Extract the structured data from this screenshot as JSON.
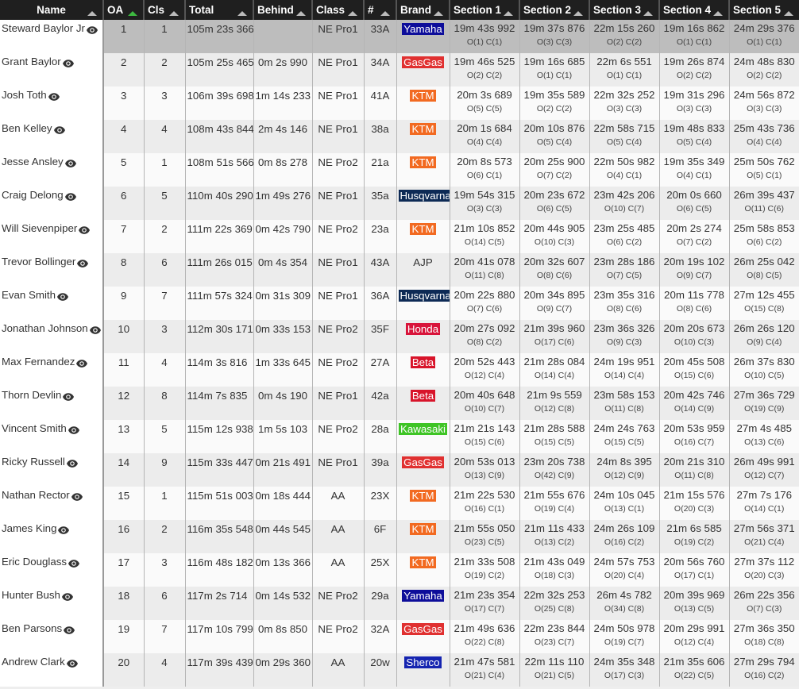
{
  "columns": [
    {
      "key": "name",
      "label": "Name"
    },
    {
      "key": "oa",
      "label": "OA",
      "sort_active": true
    },
    {
      "key": "cls",
      "label": "Cls"
    },
    {
      "key": "total",
      "label": "Total"
    },
    {
      "key": "behind",
      "label": "Behind"
    },
    {
      "key": "class",
      "label": "Class"
    },
    {
      "key": "bib",
      "label": "#"
    },
    {
      "key": "brand",
      "label": "Brand"
    },
    {
      "key": "s1",
      "label": "Section 1"
    },
    {
      "key": "s2",
      "label": "Section 2"
    },
    {
      "key": "s3",
      "label": "Section 3"
    },
    {
      "key": "s4",
      "label": "Section 4"
    },
    {
      "key": "s5",
      "label": "Section 5"
    }
  ],
  "brand_colors": {
    "Yamaha": "#0d0d9a",
    "GasGas": "#e03030",
    "KTM": "#f26a21",
    "Husqvarna": "#0d2a55",
    "AJP": "",
    "Honda": "#d8143a",
    "Beta": "#d8142a",
    "Kawasaki": "#3ec425",
    "Sherco": "#1524b0"
  },
  "rows": [
    {
      "name": "Steward Baylor Jr",
      "oa": "1",
      "cls": "1",
      "total": "105m 23s 366",
      "behind": "",
      "class": "NE Pro1",
      "bib": "33A",
      "brand": "Yamaha",
      "selected": true,
      "sections": [
        [
          "19m 43s 992",
          "O(1) C(1)"
        ],
        [
          "19m 37s 876",
          "O(3) C(3)"
        ],
        [
          "22m 15s 260",
          "O(2) C(2)"
        ],
        [
          "19m 16s 862",
          "O(1) C(1)"
        ],
        [
          "24m 29s 376",
          "O(1) C(1)"
        ]
      ]
    },
    {
      "name": "Grant Baylor",
      "oa": "2",
      "cls": "2",
      "total": "105m 25s 465",
      "behind": "0m 2s 990",
      "class": "NE Pro1",
      "bib": "34A",
      "brand": "GasGas",
      "sections": [
        [
          "19m 46s 525",
          "O(2) C(2)"
        ],
        [
          "19m 16s 685",
          "O(1) C(1)"
        ],
        [
          "22m 6s 551",
          "O(1) C(1)"
        ],
        [
          "19m 26s 874",
          "O(2) C(2)"
        ],
        [
          "24m 48s 830",
          "O(2) C(2)"
        ]
      ]
    },
    {
      "name": "Josh Toth",
      "oa": "3",
      "cls": "3",
      "total": "106m 39s 698",
      "behind": "1m 14s 233",
      "class": "NE Pro1",
      "bib": "41A",
      "brand": "KTM",
      "sections": [
        [
          "20m 3s 689",
          "O(5) C(5)"
        ],
        [
          "19m 35s 589",
          "O(2) C(2)"
        ],
        [
          "22m 32s 252",
          "O(3) C(3)"
        ],
        [
          "19m 31s 296",
          "O(3) C(3)"
        ],
        [
          "24m 56s 872",
          "O(3) C(3)"
        ]
      ]
    },
    {
      "name": "Ben Kelley",
      "oa": "4",
      "cls": "4",
      "total": "108m 43s 844",
      "behind": "2m 4s 146",
      "class": "NE Pro1",
      "bib": "38a",
      "brand": "KTM",
      "sections": [
        [
          "20m 1s 684",
          "O(4) C(4)"
        ],
        [
          "20m 10s 876",
          "O(5) C(4)"
        ],
        [
          "22m 58s 715",
          "O(5) C(4)"
        ],
        [
          "19m 48s 833",
          "O(5) C(4)"
        ],
        [
          "25m 43s 736",
          "O(4) C(4)"
        ]
      ]
    },
    {
      "name": "Jesse Ansley",
      "oa": "5",
      "cls": "1",
      "total": "108m 51s 566",
      "behind": "0m 8s 278",
      "class": "NE Pro2",
      "bib": "21a",
      "brand": "KTM",
      "sections": [
        [
          "20m 8s 573",
          "O(6) C(1)"
        ],
        [
          "20m 25s 900",
          "O(7) C(2)"
        ],
        [
          "22m 50s 982",
          "O(4) C(1)"
        ],
        [
          "19m 35s 349",
          "O(4) C(1)"
        ],
        [
          "25m 50s 762",
          "O(5) C(1)"
        ]
      ]
    },
    {
      "name": "Craig Delong",
      "oa": "6",
      "cls": "5",
      "total": "110m 40s 290",
      "behind": "1m 49s 276",
      "class": "NE Pro1",
      "bib": "35a",
      "brand": "Husqvarna",
      "sections": [
        [
          "19m 54s 315",
          "O(3) C(3)"
        ],
        [
          "20m 23s 672",
          "O(6) C(5)"
        ],
        [
          "23m 42s 206",
          "O(10) C(7)"
        ],
        [
          "20m 0s 660",
          "O(6) C(5)"
        ],
        [
          "26m 39s 437",
          "O(11) C(6)"
        ]
      ]
    },
    {
      "name": "Will Sievenpiper",
      "oa": "7",
      "cls": "2",
      "total": "111m 22s 369",
      "behind": "0m 42s 790",
      "class": "NE Pro2",
      "bib": "23a",
      "brand": "KTM",
      "sections": [
        [
          "21m 10s 852",
          "O(14) C(5)"
        ],
        [
          "20m 44s 905",
          "O(10) C(3)"
        ],
        [
          "23m 25s 485",
          "O(6) C(2)"
        ],
        [
          "20m 2s 274",
          "O(7) C(2)"
        ],
        [
          "25m 58s 853",
          "O(6) C(2)"
        ]
      ]
    },
    {
      "name": "Trevor Bollinger",
      "oa": "8",
      "cls": "6",
      "total": "111m 26s 015",
      "behind": "0m 4s 354",
      "class": "NE Pro1",
      "bib": "43A",
      "brand": "AJP",
      "sections": [
        [
          "20m 41s 078",
          "O(11) C(8)"
        ],
        [
          "20m 32s 607",
          "O(8) C(6)"
        ],
        [
          "23m 28s 186",
          "O(7) C(5)"
        ],
        [
          "20m 19s 102",
          "O(9) C(7)"
        ],
        [
          "26m 25s 042",
          "O(8) C(5)"
        ]
      ]
    },
    {
      "name": "Evan Smith",
      "oa": "9",
      "cls": "7",
      "total": "111m 57s 324",
      "behind": "0m 31s 309",
      "class": "NE Pro1",
      "bib": "36A",
      "brand": "Husqvarna",
      "sections": [
        [
          "20m 22s 880",
          "O(7) C(6)"
        ],
        [
          "20m 34s 895",
          "O(9) C(7)"
        ],
        [
          "23m 35s 316",
          "O(8) C(6)"
        ],
        [
          "20m 11s 778",
          "O(8) C(6)"
        ],
        [
          "27m 12s 455",
          "O(15) C(8)"
        ]
      ]
    },
    {
      "name": "Jonathan Johnson",
      "oa": "10",
      "cls": "3",
      "total": "112m 30s 171",
      "behind": "0m 33s 153",
      "class": "NE Pro2",
      "bib": "35F",
      "brand": "Honda",
      "sections": [
        [
          "20m 27s 092",
          "O(8) C(2)"
        ],
        [
          "21m 39s 960",
          "O(17) C(6)"
        ],
        [
          "23m 36s 326",
          "O(9) C(3)"
        ],
        [
          "20m 20s 673",
          "O(10) C(3)"
        ],
        [
          "26m 26s 120",
          "O(9) C(4)"
        ]
      ]
    },
    {
      "name": "Max Fernandez",
      "oa": "11",
      "cls": "4",
      "total": "114m 3s 816",
      "behind": "1m 33s 645",
      "class": "NE Pro2",
      "bib": "27A",
      "brand": "Beta",
      "sections": [
        [
          "20m 52s 443",
          "O(12) C(4)"
        ],
        [
          "21m 28s 084",
          "O(14) C(4)"
        ],
        [
          "24m 19s 951",
          "O(14) C(4)"
        ],
        [
          "20m 45s 508",
          "O(15) C(6)"
        ],
        [
          "26m 37s 830",
          "O(10) C(5)"
        ]
      ]
    },
    {
      "name": "Thorn Devlin",
      "oa": "12",
      "cls": "8",
      "total": "114m 7s 835",
      "behind": "0m 4s 190",
      "class": "NE Pro1",
      "bib": "42a",
      "brand": "Beta",
      "sections": [
        [
          "20m 40s 648",
          "O(10) C(7)"
        ],
        [
          "21m 9s 559",
          "O(12) C(8)"
        ],
        [
          "23m 58s 153",
          "O(11) C(8)"
        ],
        [
          "20m 42s 746",
          "O(14) C(9)"
        ],
        [
          "27m 36s 729",
          "O(19) C(9)"
        ]
      ]
    },
    {
      "name": "Vincent Smith",
      "oa": "13",
      "cls": "5",
      "total": "115m 12s 938",
      "behind": "1m 5s 103",
      "class": "NE Pro2",
      "bib": "28a",
      "brand": "Kawasaki",
      "sections": [
        [
          "21m 21s 143",
          "O(15) C(6)"
        ],
        [
          "21m 28s 588",
          "O(15) C(5)"
        ],
        [
          "24m 24s 763",
          "O(15) C(5)"
        ],
        [
          "20m 53s 959",
          "O(16) C(7)"
        ],
        [
          "27m 4s 485",
          "O(13) C(6)"
        ]
      ]
    },
    {
      "name": "Ricky Russell",
      "oa": "14",
      "cls": "9",
      "total": "115m 33s 447",
      "behind": "0m 21s 491",
      "class": "NE Pro1",
      "bib": "39a",
      "brand": "GasGas",
      "sections": [
        [
          "20m 53s 013",
          "O(13) C(9)"
        ],
        [
          "23m 20s 738",
          "O(42) C(9)"
        ],
        [
          "24m 8s 395",
          "O(12) C(9)"
        ],
        [
          "20m 21s 310",
          "O(11) C(8)"
        ],
        [
          "26m 49s 991",
          "O(12) C(7)"
        ]
      ]
    },
    {
      "name": "Nathan Rector",
      "oa": "15",
      "cls": "1",
      "total": "115m 51s 003",
      "behind": "0m 18s 444",
      "class": "AA",
      "bib": "23X",
      "brand": "KTM",
      "sections": [
        [
          "21m 22s 530",
          "O(16) C(1)"
        ],
        [
          "21m 55s 676",
          "O(19) C(4)"
        ],
        [
          "24m 10s 045",
          "O(13) C(1)"
        ],
        [
          "21m 15s 576",
          "O(20) C(3)"
        ],
        [
          "27m 7s 176",
          "O(14) C(1)"
        ]
      ]
    },
    {
      "name": "James King",
      "oa": "16",
      "cls": "2",
      "total": "116m 35s 548",
      "behind": "0m 44s 545",
      "class": "AA",
      "bib": "6F",
      "brand": "KTM",
      "sections": [
        [
          "21m 55s 050",
          "O(23) C(5)"
        ],
        [
          "21m 11s 433",
          "O(13) C(2)"
        ],
        [
          "24m 26s 109",
          "O(16) C(2)"
        ],
        [
          "21m 6s 585",
          "O(19) C(2)"
        ],
        [
          "27m 56s 371",
          "O(21) C(4)"
        ]
      ]
    },
    {
      "name": "Eric Douglass",
      "oa": "17",
      "cls": "3",
      "total": "116m 48s 182",
      "behind": "0m 13s 366",
      "class": "AA",
      "bib": "25X",
      "brand": "KTM",
      "sections": [
        [
          "21m 33s 508",
          "O(19) C(2)"
        ],
        [
          "21m 43s 049",
          "O(18) C(3)"
        ],
        [
          "24m 57s 753",
          "O(20) C(4)"
        ],
        [
          "20m 56s 760",
          "O(17) C(1)"
        ],
        [
          "27m 37s 112",
          "O(20) C(3)"
        ]
      ]
    },
    {
      "name": "Hunter Bush",
      "oa": "18",
      "cls": "6",
      "total": "117m 2s 714",
      "behind": "0m 14s 532",
      "class": "NE Pro2",
      "bib": "29a",
      "brand": "Yamaha",
      "sections": [
        [
          "21m 23s 354",
          "O(17) C(7)"
        ],
        [
          "22m 32s 253",
          "O(25) C(8)"
        ],
        [
          "26m 4s 782",
          "O(34) C(8)"
        ],
        [
          "20m 39s 969",
          "O(13) C(5)"
        ],
        [
          "26m 22s 356",
          "O(7) C(3)"
        ]
      ]
    },
    {
      "name": "Ben Parsons",
      "oa": "19",
      "cls": "7",
      "total": "117m 10s 799",
      "behind": "0m 8s 850",
      "class": "NE Pro2",
      "bib": "32A",
      "brand": "GasGas",
      "sections": [
        [
          "21m 49s 636",
          "O(22) C(8)"
        ],
        [
          "22m 23s 844",
          "O(23) C(7)"
        ],
        [
          "24m 50s 978",
          "O(19) C(7)"
        ],
        [
          "20m 29s 991",
          "O(12) C(4)"
        ],
        [
          "27m 36s 350",
          "O(18) C(8)"
        ]
      ]
    },
    {
      "name": "Andrew Clark",
      "oa": "20",
      "cls": "4",
      "total": "117m 39s 439",
      "behind": "0m 29s 360",
      "class": "AA",
      "bib": "20w",
      "brand": "Sherco",
      "sections": [
        [
          "21m 47s 581",
          "O(21) C(4)"
        ],
        [
          "22m 11s 110",
          "O(21) C(5)"
        ],
        [
          "24m 35s 348",
          "O(17) C(3)"
        ],
        [
          "21m 35s 606",
          "O(22) C(5)"
        ],
        [
          "27m 29s 794",
          "O(16) C(2)"
        ]
      ]
    }
  ]
}
